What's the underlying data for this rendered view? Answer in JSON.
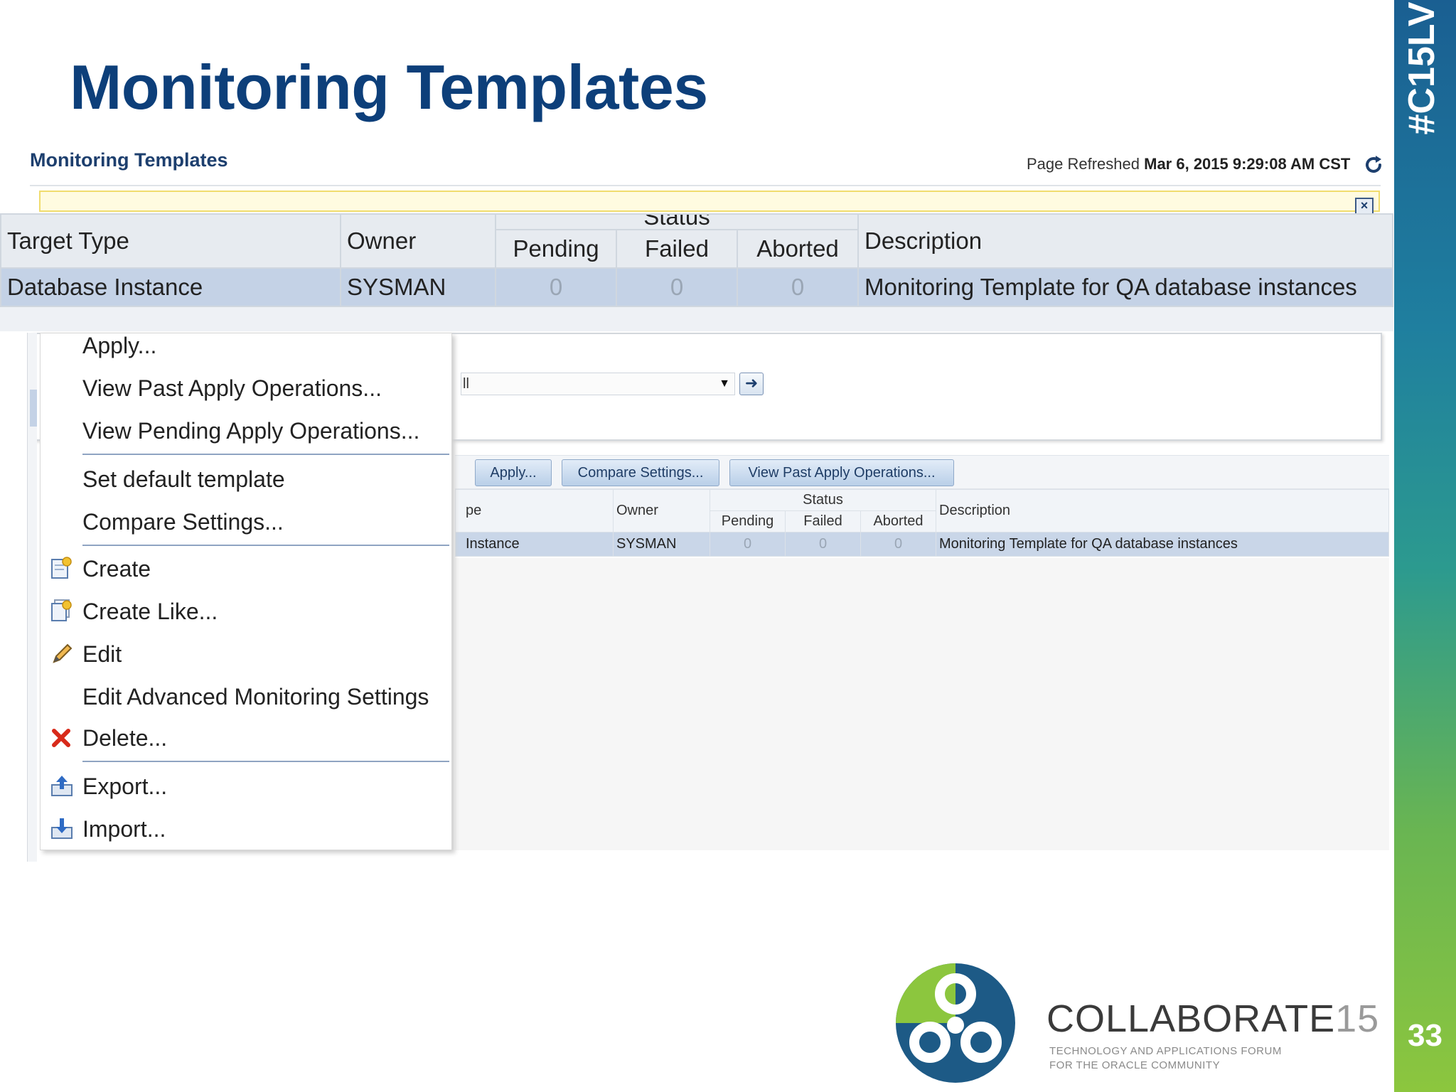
{
  "slide": {
    "title": "Monitoring Templates",
    "hashtag": "#C15LV",
    "page_number": "33"
  },
  "screen": {
    "title": "Monitoring Templates",
    "refresh_label": "Page Refreshed",
    "refresh_time": "Mar 6, 2015 9:29:08 AM CST",
    "search_value": "ll"
  },
  "zoom_table": {
    "headers": {
      "target_type": "Target Type",
      "owner": "Owner",
      "status": "Status",
      "pending": "Pending",
      "failed": "Failed",
      "aborted": "Aborted",
      "description": "Description"
    },
    "row": {
      "target_type": "Database Instance",
      "owner": "SYSMAN",
      "pending": "0",
      "failed": "0",
      "aborted": "0",
      "description": "Monitoring Template for QA database instances"
    }
  },
  "toolbar": {
    "apply": "Apply...",
    "compare": "Compare Settings...",
    "view_past": "View Past Apply Operations..."
  },
  "small_table": {
    "headers": {
      "type": "pe",
      "owner": "Owner",
      "status": "Status",
      "pending": "Pending",
      "failed": "Failed",
      "aborted": "Aborted",
      "description": "Description"
    },
    "row": {
      "type": "Instance",
      "owner": "SYSMAN",
      "pending": "0",
      "failed": "0",
      "aborted": "0",
      "description": "Monitoring Template for QA database instances"
    }
  },
  "menu": {
    "items": [
      {
        "label": "Apply..."
      },
      {
        "label": "View Past Apply Operations..."
      },
      {
        "label": "View Pending Apply Operations..."
      },
      {
        "label": "Set default template"
      },
      {
        "label": "Compare Settings..."
      },
      {
        "label": "Create",
        "icon": "create-icon"
      },
      {
        "label": "Create Like...",
        "icon": "create-like-icon"
      },
      {
        "label": "Edit",
        "icon": "pencil-icon"
      },
      {
        "label": "Edit Advanced Monitoring Settings"
      },
      {
        "label": "Delete...",
        "icon": "delete-icon"
      },
      {
        "label": "Export...",
        "icon": "export-icon"
      },
      {
        "label": "Import...",
        "icon": "import-icon"
      }
    ]
  },
  "logo": {
    "name": "COLLABORATE",
    "name_suffix": "15",
    "tagline_1": "TECHNOLOGY AND APPLICATIONS FORUM",
    "tagline_2": "FOR THE ORACLE COMMUNITY"
  },
  "colors": {
    "title": "#0d3f7a",
    "selected_row": "#c4d2e6",
    "brand_top": "#1a5f92",
    "brand_bottom": "#8cc63e"
  }
}
